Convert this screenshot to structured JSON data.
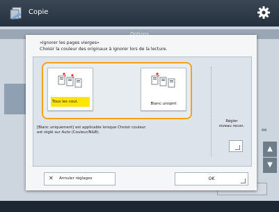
{
  "header": {
    "title": "Copie",
    "app_icon": "copy-app-icon",
    "settings_icon": "gear-icon"
  },
  "background": {
    "tab_label": "Options",
    "right_label": "ee",
    "up_arrow": "▲",
    "down_arrow": "▼"
  },
  "dialog": {
    "line1": "«Ignorer les pages vierges»",
    "line2": "Choisir la couleur des originaux à ignorer lors de la lecture.",
    "options": [
      {
        "label": "Tous les coul.",
        "selected": true
      },
      {
        "label": "Blanc uniqmt",
        "selected": false
      }
    ],
    "note_line1": "[Blanc uniquement] est applicable lorsque Choisir couleur",
    "note_line2": "est réglé sur Auto (Couleur/N&B).",
    "adjust_line1": "Régler",
    "adjust_line2": "niveau recon.",
    "cancel_label": "Annuler réglages",
    "ok_label": "OK"
  },
  "colors": {
    "highlight": "#f3a31a",
    "selected_label": "#ffe600"
  }
}
